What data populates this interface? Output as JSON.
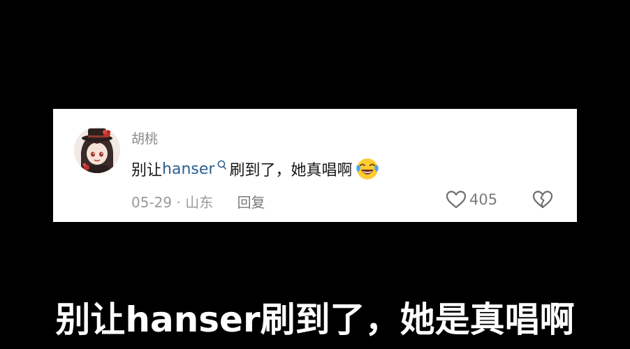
{
  "comment": {
    "username": "胡桃",
    "text_before": "别让",
    "link_text": "hanser",
    "text_after": "刷到了，她真唱啊",
    "date": "05-29",
    "separator": "·",
    "location": "山东",
    "reply_label": "回复",
    "like_count": "405",
    "icons": {
      "avatar": "avatar",
      "search": "search-icon",
      "emoji": "laughing-crying-emoji-icon",
      "like": "heart-outline-icon",
      "dislike": "broken-heart-icon"
    },
    "colors": {
      "link": "#2b5f8f",
      "meta": "#9a9a9a",
      "text": "#161616"
    }
  },
  "subtitle": {
    "text": "别让hanser刷到了，她是真唱啊"
  }
}
